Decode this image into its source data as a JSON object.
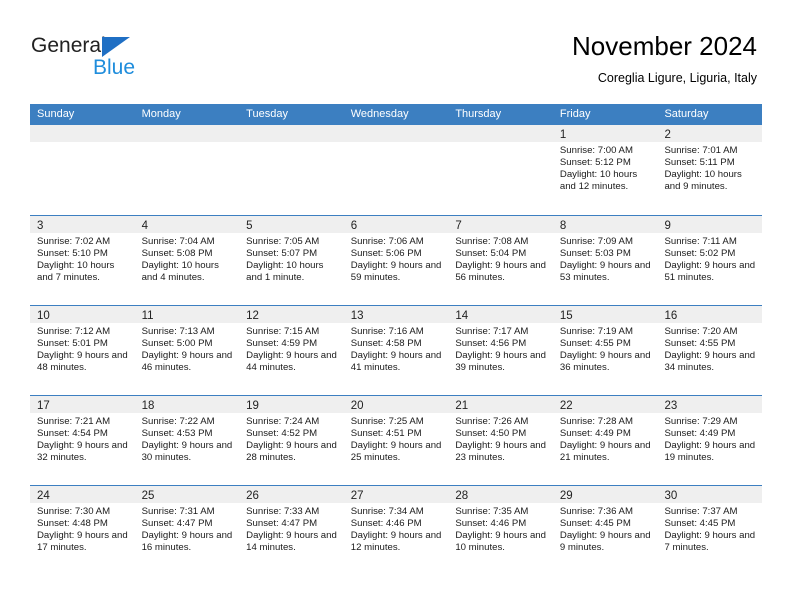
{
  "brand": {
    "name_part1": "General",
    "name_part2": "Blue",
    "triangle_color": "#1f6fc4",
    "blue_color": "#1f8ddc"
  },
  "header": {
    "title": "November 2024",
    "subtitle": "Coreglia Ligure, Liguria, Italy"
  },
  "theme": {
    "header_blue": "#3c7fc1",
    "daynum_band": "#efefef",
    "cell_background": "#ffffff"
  },
  "calendar": {
    "weekdays": [
      "Sunday",
      "Monday",
      "Tuesday",
      "Wednesday",
      "Thursday",
      "Friday",
      "Saturday"
    ],
    "weeks": [
      [
        {
          "day": "",
          "sunrise": "",
          "sunset": "",
          "daylight": "",
          "empty": true
        },
        {
          "day": "",
          "sunrise": "",
          "sunset": "",
          "daylight": "",
          "empty": true
        },
        {
          "day": "",
          "sunrise": "",
          "sunset": "",
          "daylight": "",
          "empty": true
        },
        {
          "day": "",
          "sunrise": "",
          "sunset": "",
          "daylight": "",
          "empty": true
        },
        {
          "day": "",
          "sunrise": "",
          "sunset": "",
          "daylight": "",
          "empty": true
        },
        {
          "day": "1",
          "sunrise": "Sunrise: 7:00 AM",
          "sunset": "Sunset: 5:12 PM",
          "daylight": "Daylight: 10 hours and 12 minutes.",
          "empty": false
        },
        {
          "day": "2",
          "sunrise": "Sunrise: 7:01 AM",
          "sunset": "Sunset: 5:11 PM",
          "daylight": "Daylight: 10 hours and 9 minutes.",
          "empty": false
        }
      ],
      [
        {
          "day": "3",
          "sunrise": "Sunrise: 7:02 AM",
          "sunset": "Sunset: 5:10 PM",
          "daylight": "Daylight: 10 hours and 7 minutes.",
          "empty": false
        },
        {
          "day": "4",
          "sunrise": "Sunrise: 7:04 AM",
          "sunset": "Sunset: 5:08 PM",
          "daylight": "Daylight: 10 hours and 4 minutes.",
          "empty": false
        },
        {
          "day": "5",
          "sunrise": "Sunrise: 7:05 AM",
          "sunset": "Sunset: 5:07 PM",
          "daylight": "Daylight: 10 hours and 1 minute.",
          "empty": false
        },
        {
          "day": "6",
          "sunrise": "Sunrise: 7:06 AM",
          "sunset": "Sunset: 5:06 PM",
          "daylight": "Daylight: 9 hours and 59 minutes.",
          "empty": false
        },
        {
          "day": "7",
          "sunrise": "Sunrise: 7:08 AM",
          "sunset": "Sunset: 5:04 PM",
          "daylight": "Daylight: 9 hours and 56 minutes.",
          "empty": false
        },
        {
          "day": "8",
          "sunrise": "Sunrise: 7:09 AM",
          "sunset": "Sunset: 5:03 PM",
          "daylight": "Daylight: 9 hours and 53 minutes.",
          "empty": false
        },
        {
          "day": "9",
          "sunrise": "Sunrise: 7:11 AM",
          "sunset": "Sunset: 5:02 PM",
          "daylight": "Daylight: 9 hours and 51 minutes.",
          "empty": false
        }
      ],
      [
        {
          "day": "10",
          "sunrise": "Sunrise: 7:12 AM",
          "sunset": "Sunset: 5:01 PM",
          "daylight": "Daylight: 9 hours and 48 minutes.",
          "empty": false
        },
        {
          "day": "11",
          "sunrise": "Sunrise: 7:13 AM",
          "sunset": "Sunset: 5:00 PM",
          "daylight": "Daylight: 9 hours and 46 minutes.",
          "empty": false
        },
        {
          "day": "12",
          "sunrise": "Sunrise: 7:15 AM",
          "sunset": "Sunset: 4:59 PM",
          "daylight": "Daylight: 9 hours and 44 minutes.",
          "empty": false
        },
        {
          "day": "13",
          "sunrise": "Sunrise: 7:16 AM",
          "sunset": "Sunset: 4:58 PM",
          "daylight": "Daylight: 9 hours and 41 minutes.",
          "empty": false
        },
        {
          "day": "14",
          "sunrise": "Sunrise: 7:17 AM",
          "sunset": "Sunset: 4:56 PM",
          "daylight": "Daylight: 9 hours and 39 minutes.",
          "empty": false
        },
        {
          "day": "15",
          "sunrise": "Sunrise: 7:19 AM",
          "sunset": "Sunset: 4:55 PM",
          "daylight": "Daylight: 9 hours and 36 minutes.",
          "empty": false
        },
        {
          "day": "16",
          "sunrise": "Sunrise: 7:20 AM",
          "sunset": "Sunset: 4:55 PM",
          "daylight": "Daylight: 9 hours and 34 minutes.",
          "empty": false
        }
      ],
      [
        {
          "day": "17",
          "sunrise": "Sunrise: 7:21 AM",
          "sunset": "Sunset: 4:54 PM",
          "daylight": "Daylight: 9 hours and 32 minutes.",
          "empty": false
        },
        {
          "day": "18",
          "sunrise": "Sunrise: 7:22 AM",
          "sunset": "Sunset: 4:53 PM",
          "daylight": "Daylight: 9 hours and 30 minutes.",
          "empty": false
        },
        {
          "day": "19",
          "sunrise": "Sunrise: 7:24 AM",
          "sunset": "Sunset: 4:52 PM",
          "daylight": "Daylight: 9 hours and 28 minutes.",
          "empty": false
        },
        {
          "day": "20",
          "sunrise": "Sunrise: 7:25 AM",
          "sunset": "Sunset: 4:51 PM",
          "daylight": "Daylight: 9 hours and 25 minutes.",
          "empty": false
        },
        {
          "day": "21",
          "sunrise": "Sunrise: 7:26 AM",
          "sunset": "Sunset: 4:50 PM",
          "daylight": "Daylight: 9 hours and 23 minutes.",
          "empty": false
        },
        {
          "day": "22",
          "sunrise": "Sunrise: 7:28 AM",
          "sunset": "Sunset: 4:49 PM",
          "daylight": "Daylight: 9 hours and 21 minutes.",
          "empty": false
        },
        {
          "day": "23",
          "sunrise": "Sunrise: 7:29 AM",
          "sunset": "Sunset: 4:49 PM",
          "daylight": "Daylight: 9 hours and 19 minutes.",
          "empty": false
        }
      ],
      [
        {
          "day": "24",
          "sunrise": "Sunrise: 7:30 AM",
          "sunset": "Sunset: 4:48 PM",
          "daylight": "Daylight: 9 hours and 17 minutes.",
          "empty": false
        },
        {
          "day": "25",
          "sunrise": "Sunrise: 7:31 AM",
          "sunset": "Sunset: 4:47 PM",
          "daylight": "Daylight: 9 hours and 16 minutes.",
          "empty": false
        },
        {
          "day": "26",
          "sunrise": "Sunrise: 7:33 AM",
          "sunset": "Sunset: 4:47 PM",
          "daylight": "Daylight: 9 hours and 14 minutes.",
          "empty": false
        },
        {
          "day": "27",
          "sunrise": "Sunrise: 7:34 AM",
          "sunset": "Sunset: 4:46 PM",
          "daylight": "Daylight: 9 hours and 12 minutes.",
          "empty": false
        },
        {
          "day": "28",
          "sunrise": "Sunrise: 7:35 AM",
          "sunset": "Sunset: 4:46 PM",
          "daylight": "Daylight: 9 hours and 10 minutes.",
          "empty": false
        },
        {
          "day": "29",
          "sunrise": "Sunrise: 7:36 AM",
          "sunset": "Sunset: 4:45 PM",
          "daylight": "Daylight: 9 hours and 9 minutes.",
          "empty": false
        },
        {
          "day": "30",
          "sunrise": "Sunrise: 7:37 AM",
          "sunset": "Sunset: 4:45 PM",
          "daylight": "Daylight: 9 hours and 7 minutes.",
          "empty": false
        }
      ]
    ]
  }
}
